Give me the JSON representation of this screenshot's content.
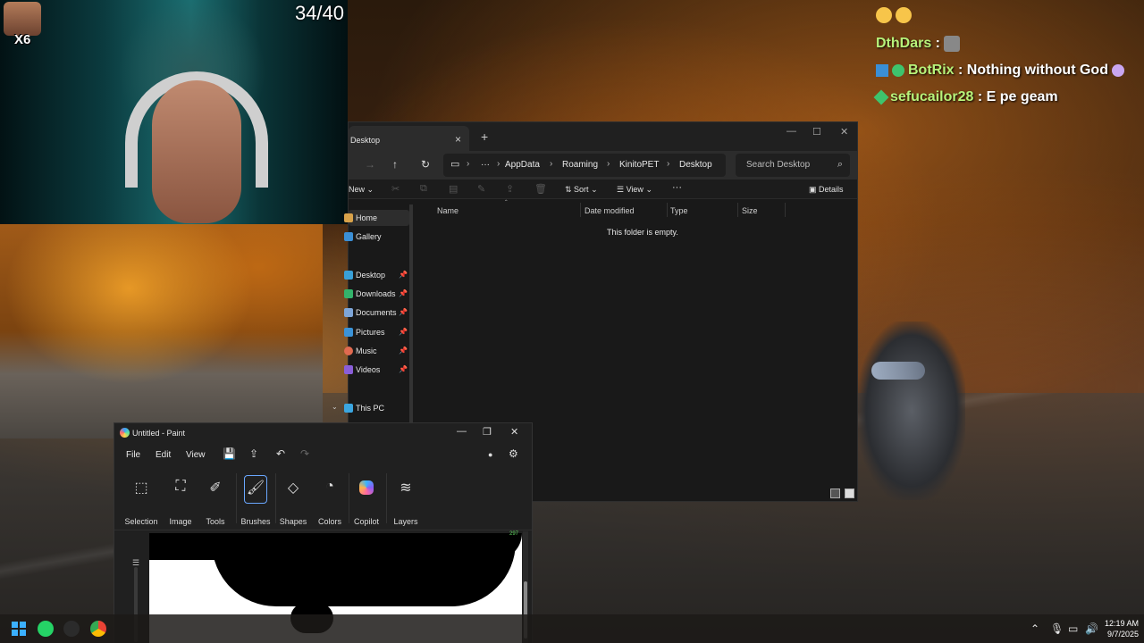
{
  "stream": {
    "counter": "34/40",
    "emote_multiplier": "X6"
  },
  "chat": {
    "lines": [
      {
        "user": "DthDars",
        "sep": " :",
        "msg": ""
      },
      {
        "user": "BotRix",
        "sep": " :",
        "msg": " Nothing without God"
      },
      {
        "user": "sefucailor28",
        "sep": " :",
        "msg": " E pe geam"
      }
    ]
  },
  "explorer": {
    "tab_title": "Desktop",
    "tab_close": "×",
    "new_tab": "+",
    "window_controls": {
      "minimize": "—",
      "maximize": "☐",
      "close": "✕"
    },
    "nav": {
      "forward": "→",
      "up": "↑",
      "refresh": "↻",
      "more": "···"
    },
    "breadcrumbs": [
      "AppData",
      "Roaming",
      "KinitoPET",
      "Desktop"
    ],
    "search_placeholder": "Search Desktop",
    "toolbar": {
      "new_label": "New",
      "sort_label": "Sort",
      "view_label": "View",
      "more_label": "···",
      "details_label": "Details"
    },
    "sidebar": [
      {
        "label": "Home",
        "icon": "home-icon",
        "pinned": false,
        "color": "#d8a24a"
      },
      {
        "label": "Gallery",
        "icon": "gallery-icon",
        "pinned": false,
        "color": "#3b8fd6"
      },
      {
        "label": "Desktop",
        "icon": "desktop-icon",
        "pinned": true,
        "color": "#39a0d8"
      },
      {
        "label": "Downloads",
        "icon": "download-icon",
        "pinned": true,
        "color": "#33b36b"
      },
      {
        "label": "Documents",
        "icon": "document-icon",
        "pinned": true,
        "color": "#7ea6d8"
      },
      {
        "label": "Pictures",
        "icon": "picture-icon",
        "pinned": true,
        "color": "#3b93d8"
      },
      {
        "label": "Music",
        "icon": "music-icon",
        "pinned": true,
        "color": "#e06a50"
      },
      {
        "label": "Videos",
        "icon": "video-icon",
        "pinned": true,
        "color": "#8a5ed8"
      },
      {
        "label": "This PC",
        "icon": "pc-icon",
        "pinned": false,
        "color": "#3ba6e0"
      }
    ],
    "columns": [
      "Name",
      "Date modified",
      "Type",
      "Size"
    ],
    "empty_message": "This folder is empty."
  },
  "paint": {
    "title": "Untitled - Paint",
    "window_controls": {
      "minimize": "—",
      "restore": "❐",
      "close": "✕"
    },
    "menu": [
      "File",
      "Edit",
      "View"
    ],
    "ribbon": [
      "Selection",
      "Image",
      "Tools",
      "Brushes",
      "Shapes",
      "Colors",
      "Copilot",
      "Layers"
    ],
    "size_label": "297"
  },
  "taskbar": {
    "time": "12:19 AM",
    "date": "9/7/2025"
  }
}
